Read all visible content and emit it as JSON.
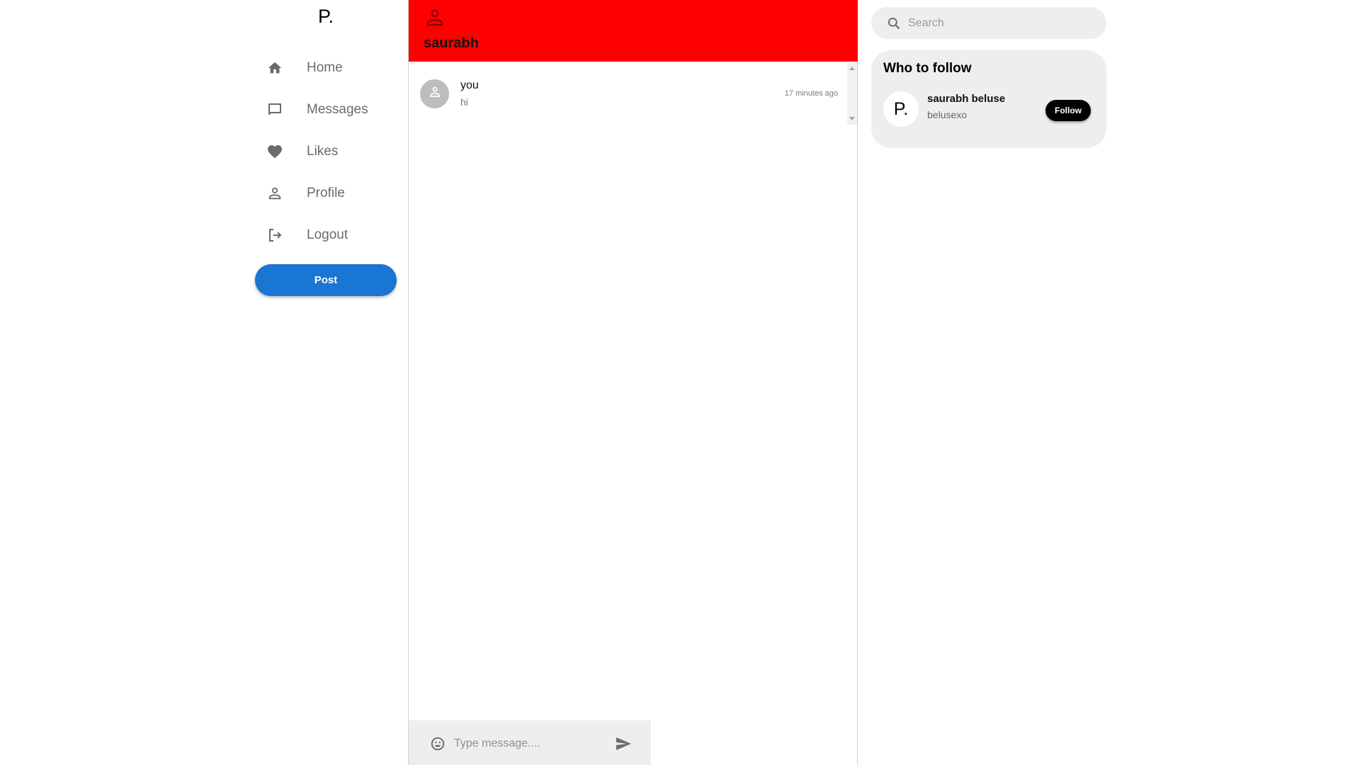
{
  "app": {
    "logo": "P."
  },
  "sidebar": {
    "items": [
      {
        "label": "Home",
        "icon": "home-icon"
      },
      {
        "label": "Messages",
        "icon": "chat-bubble-icon"
      },
      {
        "label": "Likes",
        "icon": "heart-icon"
      },
      {
        "label": "Profile",
        "icon": "person-icon"
      },
      {
        "label": "Logout",
        "icon": "logout-icon"
      }
    ],
    "post_label": "Post"
  },
  "chat": {
    "header": {
      "name": "saurabh",
      "icon": "person-icon"
    },
    "messages": [
      {
        "sender": "you",
        "text": "hi",
        "time": "17 minutes ago",
        "avatar": "person-icon"
      }
    ],
    "composer": {
      "placeholder": "Type message....",
      "value": "",
      "emoji_icon": "emoji-icon",
      "send_icon": "send-icon"
    }
  },
  "search": {
    "placeholder": "Search",
    "value": ""
  },
  "who_to_follow": {
    "title": "Who to follow",
    "users": [
      {
        "avatar_text": "P.",
        "name": "saurabh beluse",
        "handle": "belusexo",
        "button_label": "Follow"
      }
    ]
  },
  "colors": {
    "header_red": "#ff0000",
    "post_blue": "#1976d2",
    "follow_black": "#000000",
    "panel_gray": "#eeeeee"
  }
}
